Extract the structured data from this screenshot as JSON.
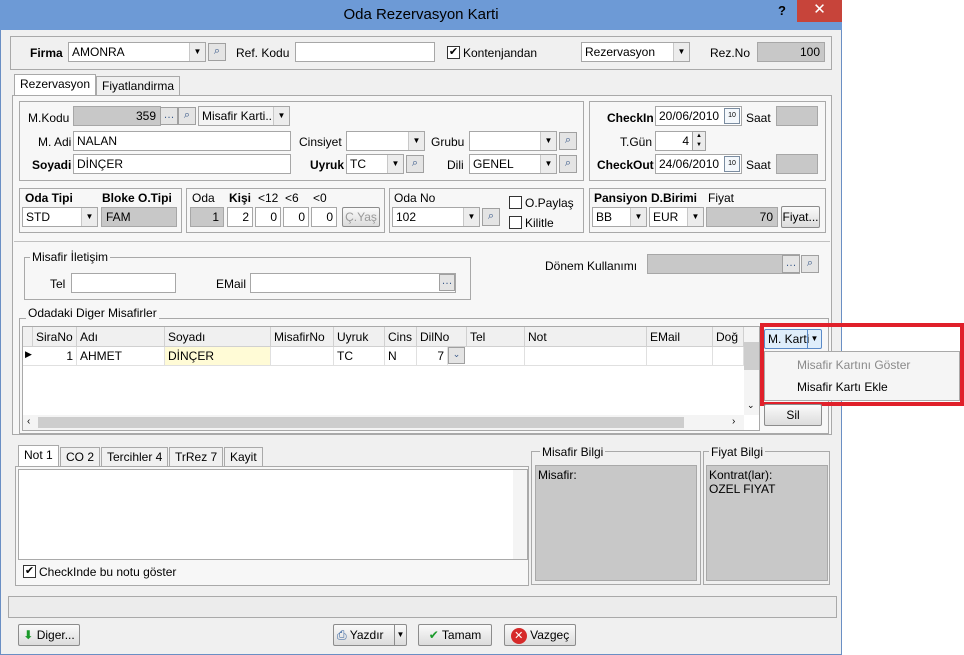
{
  "window": {
    "title": "Oda Rezervasyon Karti",
    "help": "?",
    "close": "✕"
  },
  "header": {
    "firma_label": "Firma",
    "firma_value": "AMONRA",
    "ref_kodu_label": "Ref. Kodu",
    "ref_kodu_value": "",
    "kontenjandan_label": "Kontenjandan",
    "kontenjandan_checked": "✔",
    "rez_type_value": "Rezervasyon",
    "rez_no_label": "Rez.No",
    "rez_no_value": "100"
  },
  "tabs_top": [
    "Rezervasyon",
    "Fiyatlandirma"
  ],
  "guest": {
    "mkodu_label": "M.Kodu",
    "mkodu_value": "359",
    "misafir_karti_value": "Misafir Karti...",
    "madi_label": "M. Adi",
    "madi_value": "NALAN",
    "soyadi_label": "Soyadi",
    "soyadi_value": "DİNÇER",
    "cinsiyet_label": "Cinsiyet",
    "cinsiyet_value": "",
    "grubu_label": "Grubu",
    "grubu_value": "",
    "uyruk_label": "Uyruk",
    "uyruk_value": "TC",
    "dili_label": "Dili",
    "dili_value": "GENEL"
  },
  "dates": {
    "checkin_label": "CheckIn",
    "checkin_value": "20/06/2010",
    "saat1_label": "Saat",
    "saat1_value": "",
    "tgun_label": "T.Gün",
    "tgun_value": "4",
    "checkout_label": "CheckOut",
    "checkout_value": "24/06/2010",
    "saat2_label": "Saat",
    "saat2_value": ""
  },
  "room": {
    "oda_tipi_label": "Oda Tipi",
    "oda_tipi_value": "STD",
    "bloke_label": "Bloke O.Tipi",
    "bloke_value": "FAM",
    "oda_label": "Oda",
    "kisi_label": "Kişi",
    "lt12_label": "<12",
    "lt6_label": "<6",
    "lt0_label": "<0",
    "oda_value": "1",
    "kisi_value": "2",
    "lt12_value": "0",
    "lt6_value": "0",
    "lt0_value": "0",
    "cyas_label": "Ç.Yaş",
    "oda_no_label": "Oda No",
    "oda_no_value": "102",
    "opaylas_label": "O.Paylaş",
    "kilitle_label": "Kilitle"
  },
  "pricing": {
    "pansiyon_label": "Pansiyon",
    "dbirimi_label": "D.Birimi",
    "fiyat_label": "Fiyat",
    "pansiyon_value": "BB",
    "dbirimi_value": "EUR",
    "fiyat_value": "70",
    "fiyat_button": "Fiyat..."
  },
  "contact": {
    "group_label": "Misafir İletişim",
    "tel_label": "Tel",
    "tel_value": "",
    "email_label": "EMail",
    "email_value": "",
    "donem_label": "Dönem Kullanımı",
    "donem_value": ""
  },
  "others": {
    "group_label": "Odadaki Diger Misafirler",
    "columns": [
      "SiraNo",
      "Adı",
      "Soyadı",
      "MisafirNo",
      "Uyruk",
      "Cins",
      "DilNo",
      "Tel",
      "Not",
      "EMail",
      "Doğ"
    ],
    "row": [
      "1",
      "AHMET",
      "DİNÇER",
      "",
      "TC",
      "N",
      "7",
      "",
      "",
      "",
      ""
    ],
    "mkarti_button": "M. Karti",
    "menu_items": [
      "Misafir Kartını Göster",
      "Misafir Kartı Ekle"
    ],
    "sil_button": "Sil"
  },
  "tabs_bottom": [
    "Not 1",
    "CO 2",
    "Tercihler 4",
    "TrRez 7",
    "Kayit"
  ],
  "notes": {
    "checkin_note_label": "CheckInde bu notu göster"
  },
  "misafir_bilgi": {
    "label": "Misafir Bilgi",
    "content": "Misafir:"
  },
  "fiyat_bilgi": {
    "label": "Fiyat Bilgi",
    "line1": "Kontrat(lar):",
    "line2": "OZEL FIYAT"
  },
  "footer": {
    "diger": "Diger...",
    "yazdir": "Yazdır",
    "tamam": "Tamam",
    "vazgec": "Vazgeç"
  },
  "colors": {
    "titlebar": "#6d9ad6",
    "close": "#c7443a",
    "highlight_box": "#e0202a"
  }
}
